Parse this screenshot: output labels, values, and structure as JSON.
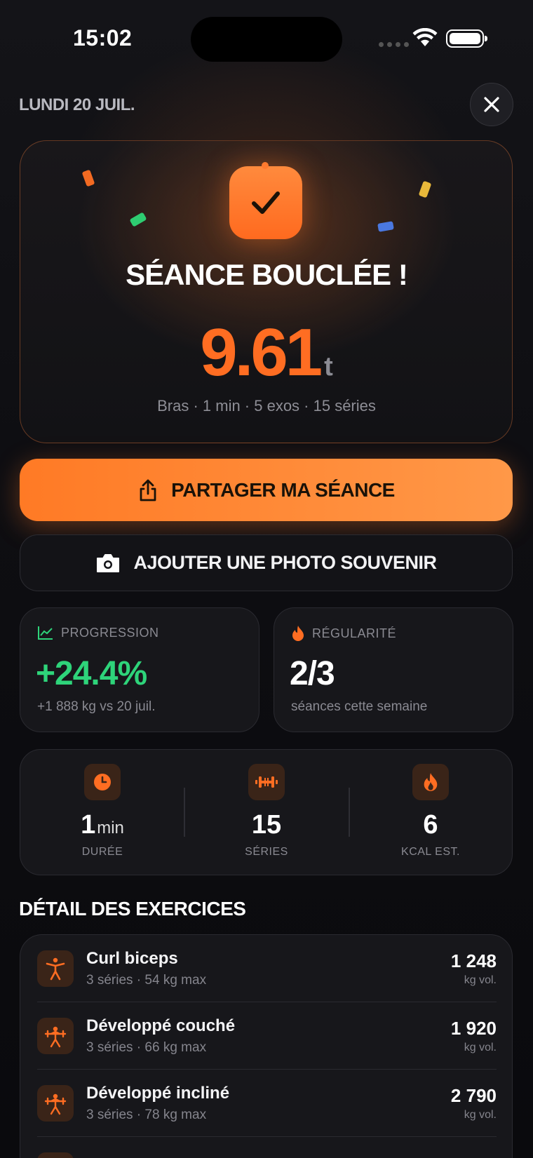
{
  "status_bar": {
    "time": "15:02"
  },
  "header": {
    "date": "LUNDI 20 JUIL."
  },
  "hero": {
    "title": "SÉANCE BOUCLÉE !",
    "value": "9.61",
    "unit": "t",
    "subtitle": "Bras · 1 min · 5 exos · 15 séries"
  },
  "actions": {
    "share_label": "PARTAGER MA SÉANCE",
    "photo_label": "AJOUTER UNE PHOTO SOUVENIR"
  },
  "progression": {
    "title": "PROGRESSION",
    "value": "+24.4%",
    "detail": "+1 888 kg vs 20 juil."
  },
  "regularity": {
    "title": "RÉGULARITÉ",
    "value": "2/3",
    "detail": "séances cette semaine"
  },
  "metrics": [
    {
      "value": "1",
      "unit": "min",
      "label": "DURÉE",
      "icon": "clock-icon"
    },
    {
      "value": "15",
      "unit": "",
      "label": "SÉRIES",
      "icon": "dumbbell-icon"
    },
    {
      "value": "6",
      "unit": "",
      "label": "KCAL EST.",
      "icon": "flame-icon"
    }
  ],
  "exercises_section": {
    "title": "DÉTAIL DES EXERCICES"
  },
  "exercises": [
    {
      "name": "Curl biceps",
      "meta": "3 séries · 54 kg max",
      "volume": "1 248",
      "volume_unit": "kg vol."
    },
    {
      "name": "Développé couché",
      "meta": "3 séries · 66 kg max",
      "volume": "1 920",
      "volume_unit": "kg vol."
    },
    {
      "name": "Développé incliné",
      "meta": "3 séries · 78 kg max",
      "volume": "2 790",
      "volume_unit": "kg vol."
    }
  ],
  "colors": {
    "accent": "#ff6d22",
    "positive": "#2ed47a",
    "background": "#0d0d10"
  }
}
